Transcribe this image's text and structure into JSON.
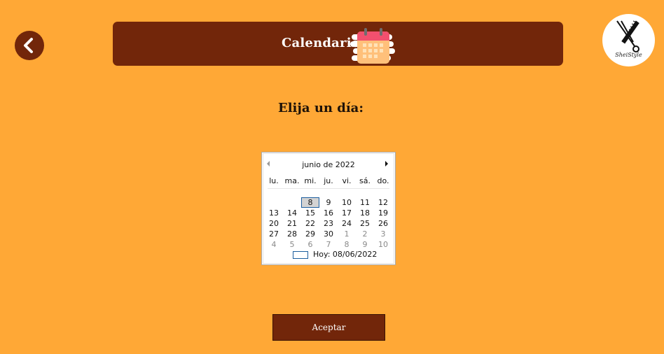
{
  "header": {
    "title": "Calendario",
    "back_icon": "chevron-left-icon",
    "calendar_icon": "calendar-icon"
  },
  "logo": {
    "text": "SheiStyle",
    "icon": "scissors-comb-icon"
  },
  "prompt": "Elija un día:",
  "calendar": {
    "month_label": "junio de 2022",
    "weekdays": [
      "lu.",
      "ma.",
      "mi.",
      "ju.",
      "vi.",
      "sá.",
      "do."
    ],
    "weeks": [
      [
        {
          "d": "",
          "m": false
        },
        {
          "d": "",
          "m": false
        },
        {
          "d": "8",
          "m": false,
          "sel": true
        },
        {
          "d": "9",
          "m": false
        },
        {
          "d": "10",
          "m": false
        },
        {
          "d": "11",
          "m": false
        },
        {
          "d": "12",
          "m": false
        }
      ],
      [
        {
          "d": "13",
          "m": false
        },
        {
          "d": "14",
          "m": false
        },
        {
          "d": "15",
          "m": false
        },
        {
          "d": "16",
          "m": false
        },
        {
          "d": "17",
          "m": false
        },
        {
          "d": "18",
          "m": false
        },
        {
          "d": "19",
          "m": false
        }
      ],
      [
        {
          "d": "20",
          "m": false
        },
        {
          "d": "21",
          "m": false
        },
        {
          "d": "22",
          "m": false
        },
        {
          "d": "23",
          "m": false
        },
        {
          "d": "24",
          "m": false
        },
        {
          "d": "25",
          "m": false
        },
        {
          "d": "26",
          "m": false
        }
      ],
      [
        {
          "d": "27",
          "m": false
        },
        {
          "d": "28",
          "m": false
        },
        {
          "d": "29",
          "m": false
        },
        {
          "d": "30",
          "m": false
        },
        {
          "d": "1",
          "m": true
        },
        {
          "d": "2",
          "m": true
        },
        {
          "d": "3",
          "m": true
        }
      ],
      [
        {
          "d": "4",
          "m": true
        },
        {
          "d": "5",
          "m": true
        },
        {
          "d": "6",
          "m": true
        },
        {
          "d": "7",
          "m": true
        },
        {
          "d": "8",
          "m": true
        },
        {
          "d": "9",
          "m": true
        },
        {
          "d": "10",
          "m": true
        }
      ]
    ],
    "selected_day": "8",
    "today_label": "Hoy: 08/06/2022"
  },
  "accept_label": "Aceptar",
  "colors": {
    "background": "#FFA836",
    "brand": "#72260A",
    "selection_border": "#1C5E9E"
  }
}
